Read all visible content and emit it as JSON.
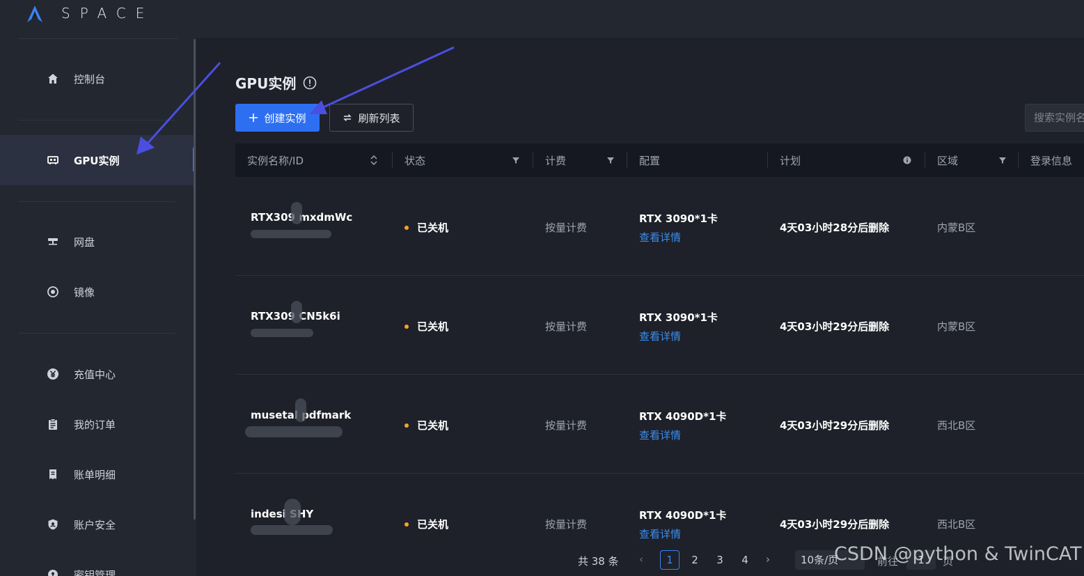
{
  "brand": {
    "name": "SPACE"
  },
  "sidebar": {
    "items": [
      {
        "label": "控制台",
        "icon": "home-icon"
      },
      {
        "label": "GPU实例",
        "icon": "gpu-icon"
      },
      {
        "label": "网盘",
        "icon": "network-disk-icon"
      },
      {
        "label": "镜像",
        "icon": "image-icon"
      },
      {
        "label": "充值中心",
        "icon": "yen-icon"
      },
      {
        "label": "我的订单",
        "icon": "clipboard-icon"
      },
      {
        "label": "账单明细",
        "icon": "bill-icon"
      },
      {
        "label": "账户安全",
        "icon": "shield-icon"
      },
      {
        "label": "密钥管理",
        "icon": "key-icon"
      }
    ],
    "active_index": 1
  },
  "main": {
    "title": "GPU实例",
    "create_button": "创建实例",
    "refresh_button": "刷新列表",
    "search_placeholder": "搜索实例名"
  },
  "table": {
    "columns": [
      "实例名称/ID",
      "状态",
      "计费",
      "配置",
      "计划",
      "区域",
      "登录信息"
    ],
    "rows": [
      {
        "name": "RTX309  mxdmWc",
        "status": "已关机",
        "billing": "按量计费",
        "config": "RTX 3090*1卡",
        "detail": "查看详情",
        "plan": "4天03小时28分后删除",
        "region": "内蒙B区"
      },
      {
        "name": "RTX309  CN5k6i",
        "status": "已关机",
        "billing": "按量计费",
        "config": "RTX 3090*1卡",
        "detail": "查看详情",
        "plan": "4天03小时29分后删除",
        "region": "内蒙B区"
      },
      {
        "name": "musetal  pdfmark",
        "status": "已关机",
        "billing": "按量计费",
        "config": "RTX 4090D*1卡",
        "detail": "查看详情",
        "plan": "4天03小时29分后删除",
        "region": "西北B区"
      },
      {
        "name": "indesi   SHY",
        "status": "已关机",
        "billing": "按量计费",
        "config": "RTX 4090D*1卡",
        "detail": "查看详情",
        "plan": "4天03小时29分后删除",
        "region": "西北B区"
      }
    ]
  },
  "pagination": {
    "total": "共 38 条",
    "pages": [
      "1",
      "2",
      "3",
      "4"
    ],
    "current": "1",
    "page_size": "10条/页",
    "goto": "前往",
    "goto_value": "1",
    "page_unit": "页"
  },
  "watermark": "CSDN @python & TwinCAT",
  "colors": {
    "accent": "#2e6ff2",
    "link": "#3b8ef0",
    "status_off": "#f5a623",
    "arrow": "#4a4fe0"
  }
}
